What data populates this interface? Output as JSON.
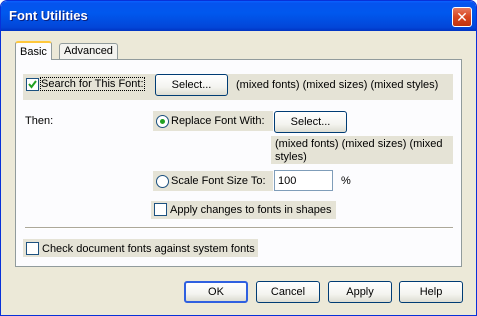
{
  "window": {
    "title": "Font Utilities",
    "close_glyph": "✕"
  },
  "tabs": [
    {
      "label": "Basic"
    },
    {
      "label": "Advanced"
    }
  ],
  "search": {
    "label": "Search for This Font:",
    "checked": true,
    "select_label": "Select...",
    "description": "(mixed fonts) (mixed sizes)  (mixed styles)"
  },
  "then_label": "Then:",
  "replace": {
    "label": "Replace Font With:",
    "selected": true,
    "select_label": "Select...",
    "description_line1": "(mixed fonts) (mixed sizes)  (mixed",
    "description_line2": "styles)"
  },
  "scale": {
    "label": "Scale Font Size To:",
    "value": "100",
    "unit": "%"
  },
  "apply_shapes": {
    "label": "Apply changes to fonts in shapes",
    "checked": false
  },
  "check_system": {
    "label": "Check document fonts against system fonts",
    "checked": false
  },
  "buttons": {
    "ok": "OK",
    "cancel": "Cancel",
    "apply": "Apply",
    "help": "Help"
  },
  "colors": {
    "title_bar": "#0058ee",
    "dialog_bg": "#ece9d8",
    "radio_dot": "#21a121",
    "check_mark": "#21a121"
  }
}
